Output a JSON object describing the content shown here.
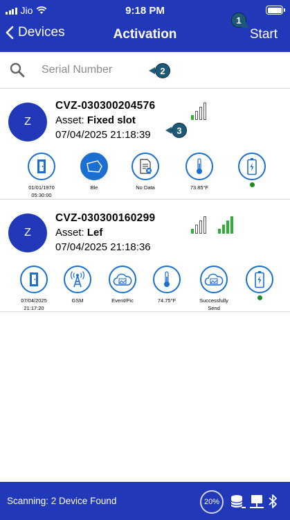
{
  "status_bar": {
    "carrier": "Jio",
    "time": "9:18 PM"
  },
  "nav": {
    "back_label": "Devices",
    "title": "Activation",
    "start_label": "Start"
  },
  "search": {
    "placeholder": "Serial Number"
  },
  "markers": {
    "m1": "1",
    "m2": "2",
    "m3": "3"
  },
  "devices": [
    {
      "avatar": "Z",
      "serial": "CVZ-030300204576",
      "asset_label": "Asset: ",
      "asset_value": "Fixed slot",
      "datetime": "07/04/2025  21:18:39",
      "signal_bars_on": 1,
      "icons": [
        {
          "name": "door-icon",
          "label": "01/01/1970\n05:30:00"
        },
        {
          "name": "ble-tag-icon",
          "label": "Ble"
        },
        {
          "name": "no-data-icon",
          "label": "No Data"
        },
        {
          "name": "thermometer-icon",
          "label": "73.85°F"
        },
        {
          "name": "battery-icon",
          "label": ""
        }
      ]
    },
    {
      "avatar": "Z",
      "serial": "CVZ-030300160299",
      "asset_label": "Asset: ",
      "asset_value": "Lef",
      "datetime": "07/04/2025  21:18:36",
      "signal_bars_on": 1,
      "signal2_bars_on": 4,
      "icons": [
        {
          "name": "door-icon",
          "label": "07/04/2025\n21:17:20"
        },
        {
          "name": "gsm-tower-icon",
          "label": "GSM"
        },
        {
          "name": "cloud-image-icon",
          "label": "Event/Pic"
        },
        {
          "name": "thermometer-icon",
          "label": "74.75°F"
        },
        {
          "name": "cloud-image-icon",
          "label": "Successfully\nSend"
        },
        {
          "name": "battery-icon",
          "label": ""
        }
      ]
    }
  ],
  "footer": {
    "scan_status": "Scanning: 2 Device Found",
    "progress_percent": "20%"
  },
  "colors": {
    "primary": "#2138b8",
    "signal_green": "#2fae38",
    "icon_blue": "#1a6fd0",
    "marker": "#1d5a78"
  }
}
